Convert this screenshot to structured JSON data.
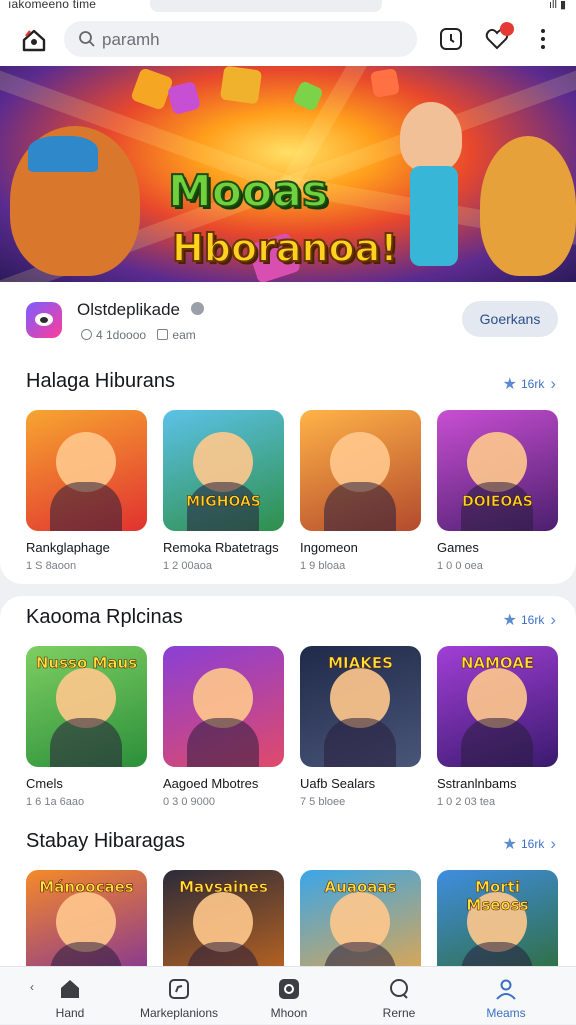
{
  "status": {
    "left": "ıakomeeno time",
    "right": "ıll ▮"
  },
  "search": {
    "placeholder": "paramh"
  },
  "banner": {
    "title": "Mooas",
    "subtitle": "Hboranoa!"
  },
  "app": {
    "name": "Olstdeplikade",
    "rating": "4 1doooo",
    "size": "eam",
    "button": "Goerkans"
  },
  "sections": [
    {
      "title": "Halaga Hiburans",
      "more": "16rk",
      "items": [
        {
          "name": "Rankglaphage",
          "sub": "1 S 8aoon",
          "label": "",
          "colors": [
            "#f7a531",
            "#e0322f"
          ]
        },
        {
          "name": "Remoka Rbatetrags",
          "sub": "1 2 00aoa",
          "label": "MIGHOAS",
          "colors": [
            "#5cc2e8",
            "#2e8f4a"
          ]
        },
        {
          "name": "Ingomeon",
          "sub": "1 9 bloaa",
          "label": "",
          "colors": [
            "#ffb347",
            "#b34a2d"
          ]
        },
        {
          "name": "Games",
          "sub": "1 0 0 oea",
          "label": "DOIEOAS",
          "colors": [
            "#c94fd3",
            "#4b1f6e"
          ]
        }
      ]
    },
    {
      "title": "Kaooma Rplcinas",
      "more": "16rk",
      "items": [
        {
          "name": "Cmels",
          "sub": "1 6 1a 6aao",
          "label": "Nusso Maus",
          "colors": [
            "#7ecf62",
            "#2b8f3a"
          ]
        },
        {
          "name": "Aagoed Mbotres",
          "sub": "0 3 0 9000",
          "label": "",
          "colors": [
            "#8a3fd6",
            "#e04a6a"
          ]
        },
        {
          "name": "Uafb Sealars",
          "sub": "7 5 bloee",
          "label": "MIAKES",
          "colors": [
            "#1f2a4a",
            "#4a5678"
          ]
        },
        {
          "name": "Sstranlnbams",
          "sub": "1 0 2 03 tea",
          "label": "NAMOAE",
          "colors": [
            "#a13fd6",
            "#3a1a6e"
          ]
        }
      ]
    },
    {
      "title": "Stabay Hibaragas",
      "more": "16rk",
      "items": [
        {
          "name": "",
          "sub": "",
          "label": "Mánoocaes",
          "colors": [
            "#f58a2a",
            "#7a2e9e"
          ]
        },
        {
          "name": "",
          "sub": "",
          "label": "Mavsaines",
          "colors": [
            "#2b2b3a",
            "#c96a1e"
          ]
        },
        {
          "name": "",
          "sub": "",
          "label": "Auaoaas",
          "colors": [
            "#3aa6e8",
            "#f0a640"
          ]
        },
        {
          "name": "",
          "sub": "",
          "label": "Morti Mseoss",
          "colors": [
            "#3f8de0",
            "#2e6b2e"
          ]
        }
      ]
    }
  ],
  "nav": [
    {
      "label": "Hand",
      "icon": "home-icon"
    },
    {
      "label": "Markeplanions",
      "icon": "compass-icon"
    },
    {
      "label": "Mhoon",
      "icon": "media-icon"
    },
    {
      "label": "Rerne",
      "icon": "chat-icon"
    },
    {
      "label": "Meams",
      "icon": "profile-icon"
    }
  ],
  "colors": {
    "accent": "#3a6fc4",
    "badge": "#e53935"
  }
}
